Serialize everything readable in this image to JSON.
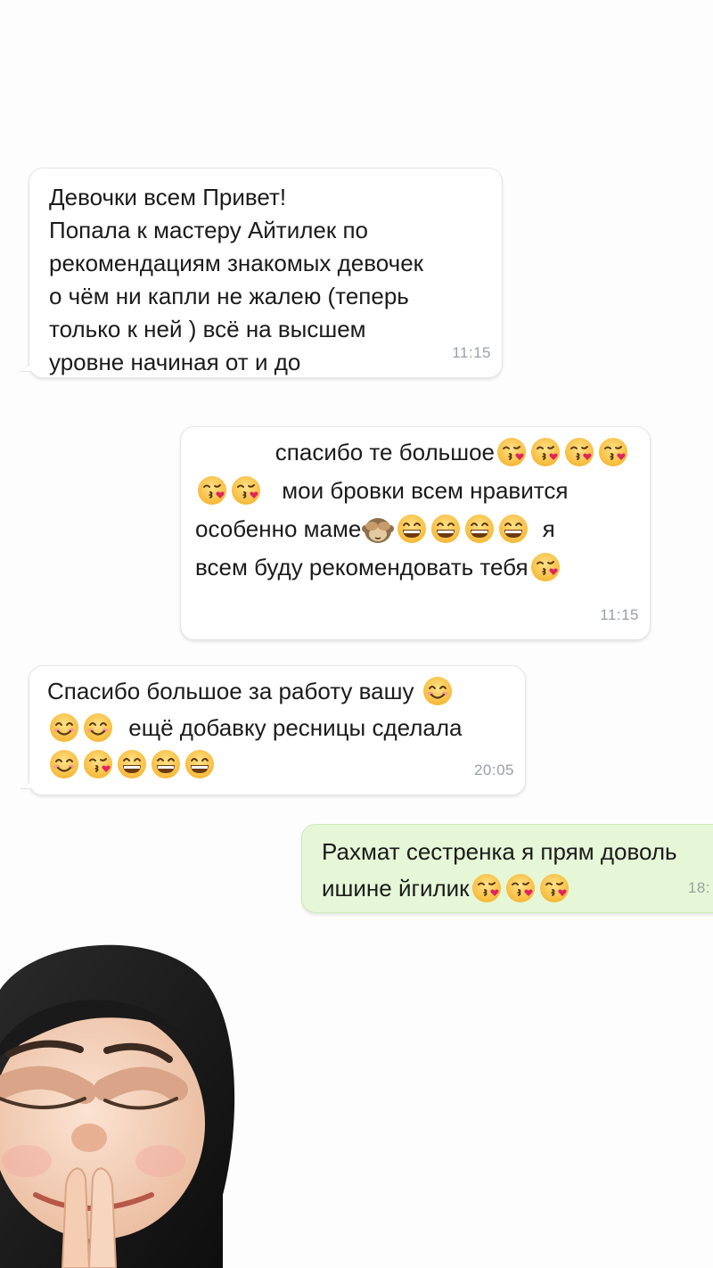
{
  "messages": [
    {
      "direction": "incoming",
      "text": "Девочки всем Привет!\nПопала к  мастеру Айтилек по\nрекомендациям знакомых девочек\nо чём ни капли не жалею (теперь\nтолько к ней ) всё на высшем\nуровне начиная от и до",
      "time": "11:15"
    },
    {
      "direction": "outgoing",
      "lines": [
        {
          "text": "спасибо те большое",
          "emoji_after": [
            "kiss-emoji",
            "kiss-emoji",
            "kiss-emoji",
            "kiss-emoji"
          ]
        },
        {
          "emoji_before": [
            "kiss-emoji",
            "kiss-emoji"
          ],
          "text": "мои бровки всем нравится"
        },
        {
          "text": "особенно маме",
          "emoji_after": [
            "see-no-evil-monkey-emoji",
            "grin-emoji",
            "grin-emoji",
            "grin-emoji",
            "grin-emoji"
          ],
          "tail": "я"
        },
        {
          "text": "всем буду рекомендовать тебя",
          "emoji_after": [
            "kiss-emoji"
          ]
        }
      ],
      "time": "11:15"
    },
    {
      "direction": "incoming",
      "lines": [
        {
          "text": "Спасибо большое за работу вашу",
          "emoji_after": [
            "smile-emoji"
          ]
        },
        {
          "emoji_before": [
            "smile-emoji",
            "smile-emoji"
          ],
          "text": "ещё добавку ресницы сделала"
        },
        {
          "emoji_only": [
            "smile-emoji",
            "kiss-emoji",
            "grin-emoji",
            "grin-emoji",
            "grin-emoji"
          ]
        }
      ],
      "time": "20:05"
    },
    {
      "direction": "outgoing-green",
      "lines": [
        {
          "text": "Рахмат сестренка я прям доволь"
        },
        {
          "text": "ишине йгилик",
          "emoji_after": [
            "kiss-emoji",
            "kiss-emoji",
            "kiss-emoji"
          ]
        }
      ],
      "time": "18:"
    }
  ],
  "avatar": {
    "name": "memoji-avatar-praying"
  },
  "colors": {
    "bubble_white": "#ffffff",
    "bubble_green": "#e5f7d6",
    "time_gray": "#9aa0a6",
    "background": "#fdfdfd"
  }
}
